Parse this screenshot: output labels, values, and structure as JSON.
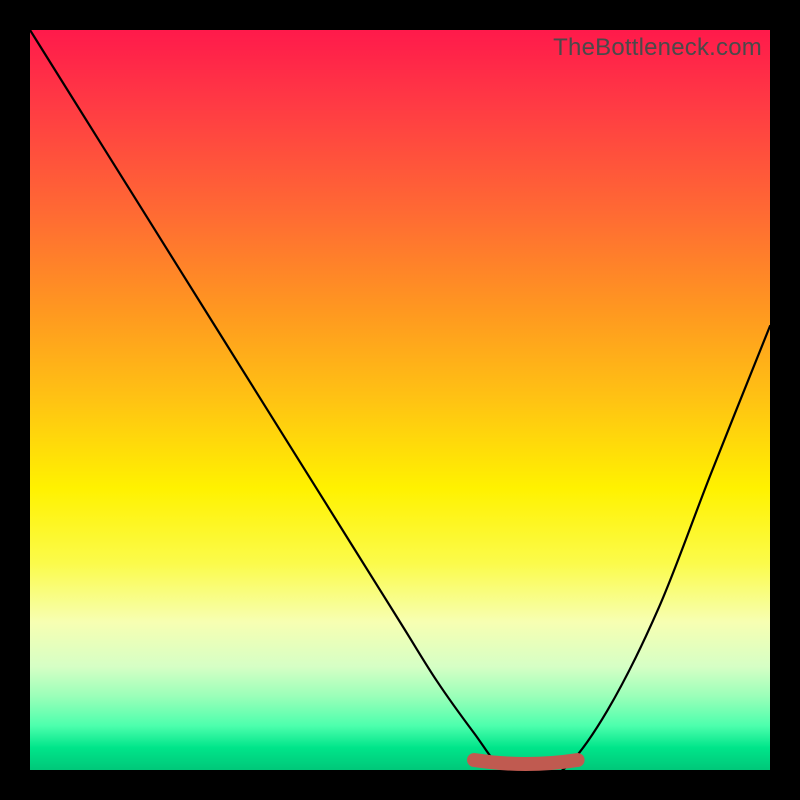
{
  "watermark": "TheBottleneck.com",
  "colors": {
    "frame": "#000000",
    "curve": "#000000",
    "bottom_segment": "#c05a50"
  },
  "chart_data": {
    "type": "line",
    "title": "",
    "xlabel": "",
    "ylabel": "",
    "xlim": [
      0,
      100
    ],
    "ylim": [
      0,
      100
    ],
    "series": [
      {
        "name": "curve",
        "x": [
          0,
          10,
          20,
          30,
          40,
          50,
          55,
          60,
          64,
          68,
          72,
          78,
          85,
          92,
          100
        ],
        "y": [
          100,
          84,
          68,
          52,
          36,
          20,
          12,
          5,
          0,
          0,
          0,
          8,
          22,
          40,
          60
        ]
      }
    ],
    "annotations": [
      {
        "name": "optimal-range",
        "x_start": 60,
        "x_end": 74,
        "y": 0
      }
    ]
  }
}
